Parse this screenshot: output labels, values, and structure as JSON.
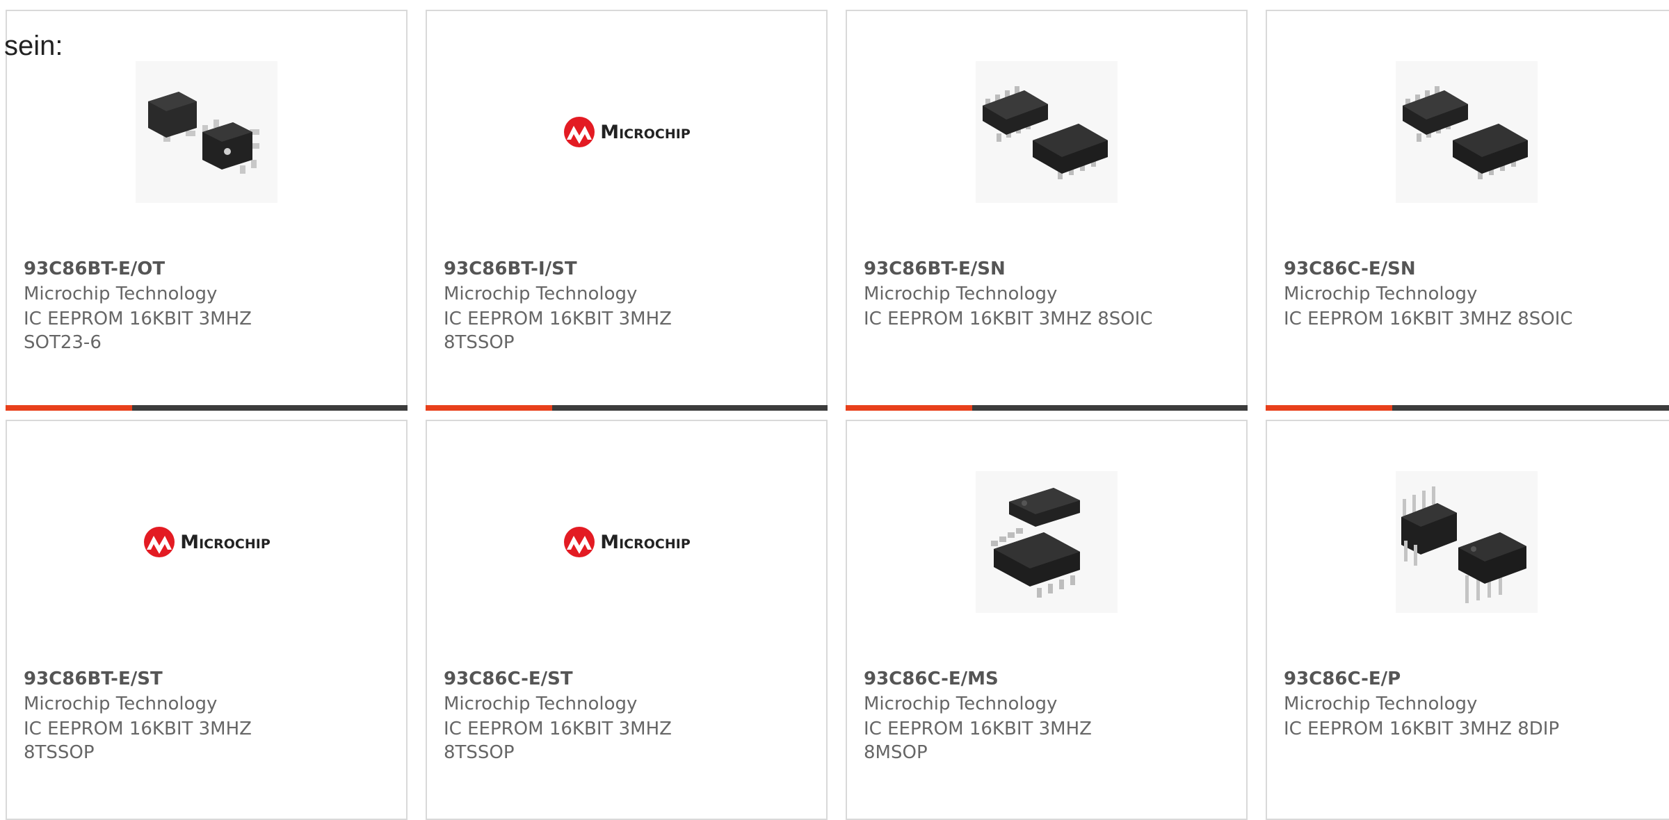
{
  "intro_text": "sein:",
  "colors": {
    "accent": "#e8401b",
    "bar": "#3c3c3c",
    "logo_red": "#e31b23"
  },
  "products": [
    {
      "part_number": "93C86BT-E/OT",
      "manufacturer": "Microchip Technology",
      "description": "IC EEPROM 16KBIT 3MHZ SOT23-6",
      "image": "sot23-6-package-icon"
    },
    {
      "part_number": "93C86BT-I/ST",
      "manufacturer": "Microchip Technology",
      "description": "IC EEPROM 16KBIT 3MHZ 8TSSOP",
      "image": "microchip-logo",
      "logo_text": "Microchip"
    },
    {
      "part_number": "93C86BT-E/SN",
      "manufacturer": "Microchip Technology",
      "description": "IC EEPROM 16KBIT 3MHZ 8SOIC",
      "image": "soic8-package-icon"
    },
    {
      "part_number": "93C86C-E/SN",
      "manufacturer": "Microchip Technology",
      "description": "IC EEPROM 16KBIT 3MHZ 8SOIC",
      "image": "soic8-package-icon"
    },
    {
      "part_number": "93C86BT-E/ST",
      "manufacturer": "Microchip Technology",
      "description": "IC EEPROM 16KBIT 3MHZ 8TSSOP",
      "image": "microchip-logo",
      "logo_text": "Microchip"
    },
    {
      "part_number": "93C86C-E/ST",
      "manufacturer": "Microchip Technology",
      "description": "IC EEPROM 16KBIT 3MHZ 8TSSOP",
      "image": "microchip-logo",
      "logo_text": "Microchip"
    },
    {
      "part_number": "93C86C-E/MS",
      "manufacturer": "Microchip Technology",
      "description": "IC EEPROM 16KBIT 3MHZ 8MSOP",
      "image": "msop8-package-icon"
    },
    {
      "part_number": "93C86C-E/P",
      "manufacturer": "Microchip Technology",
      "description": "IC EEPROM 16KBIT 3MHZ 8DIP",
      "image": "dip8-package-icon"
    }
  ]
}
